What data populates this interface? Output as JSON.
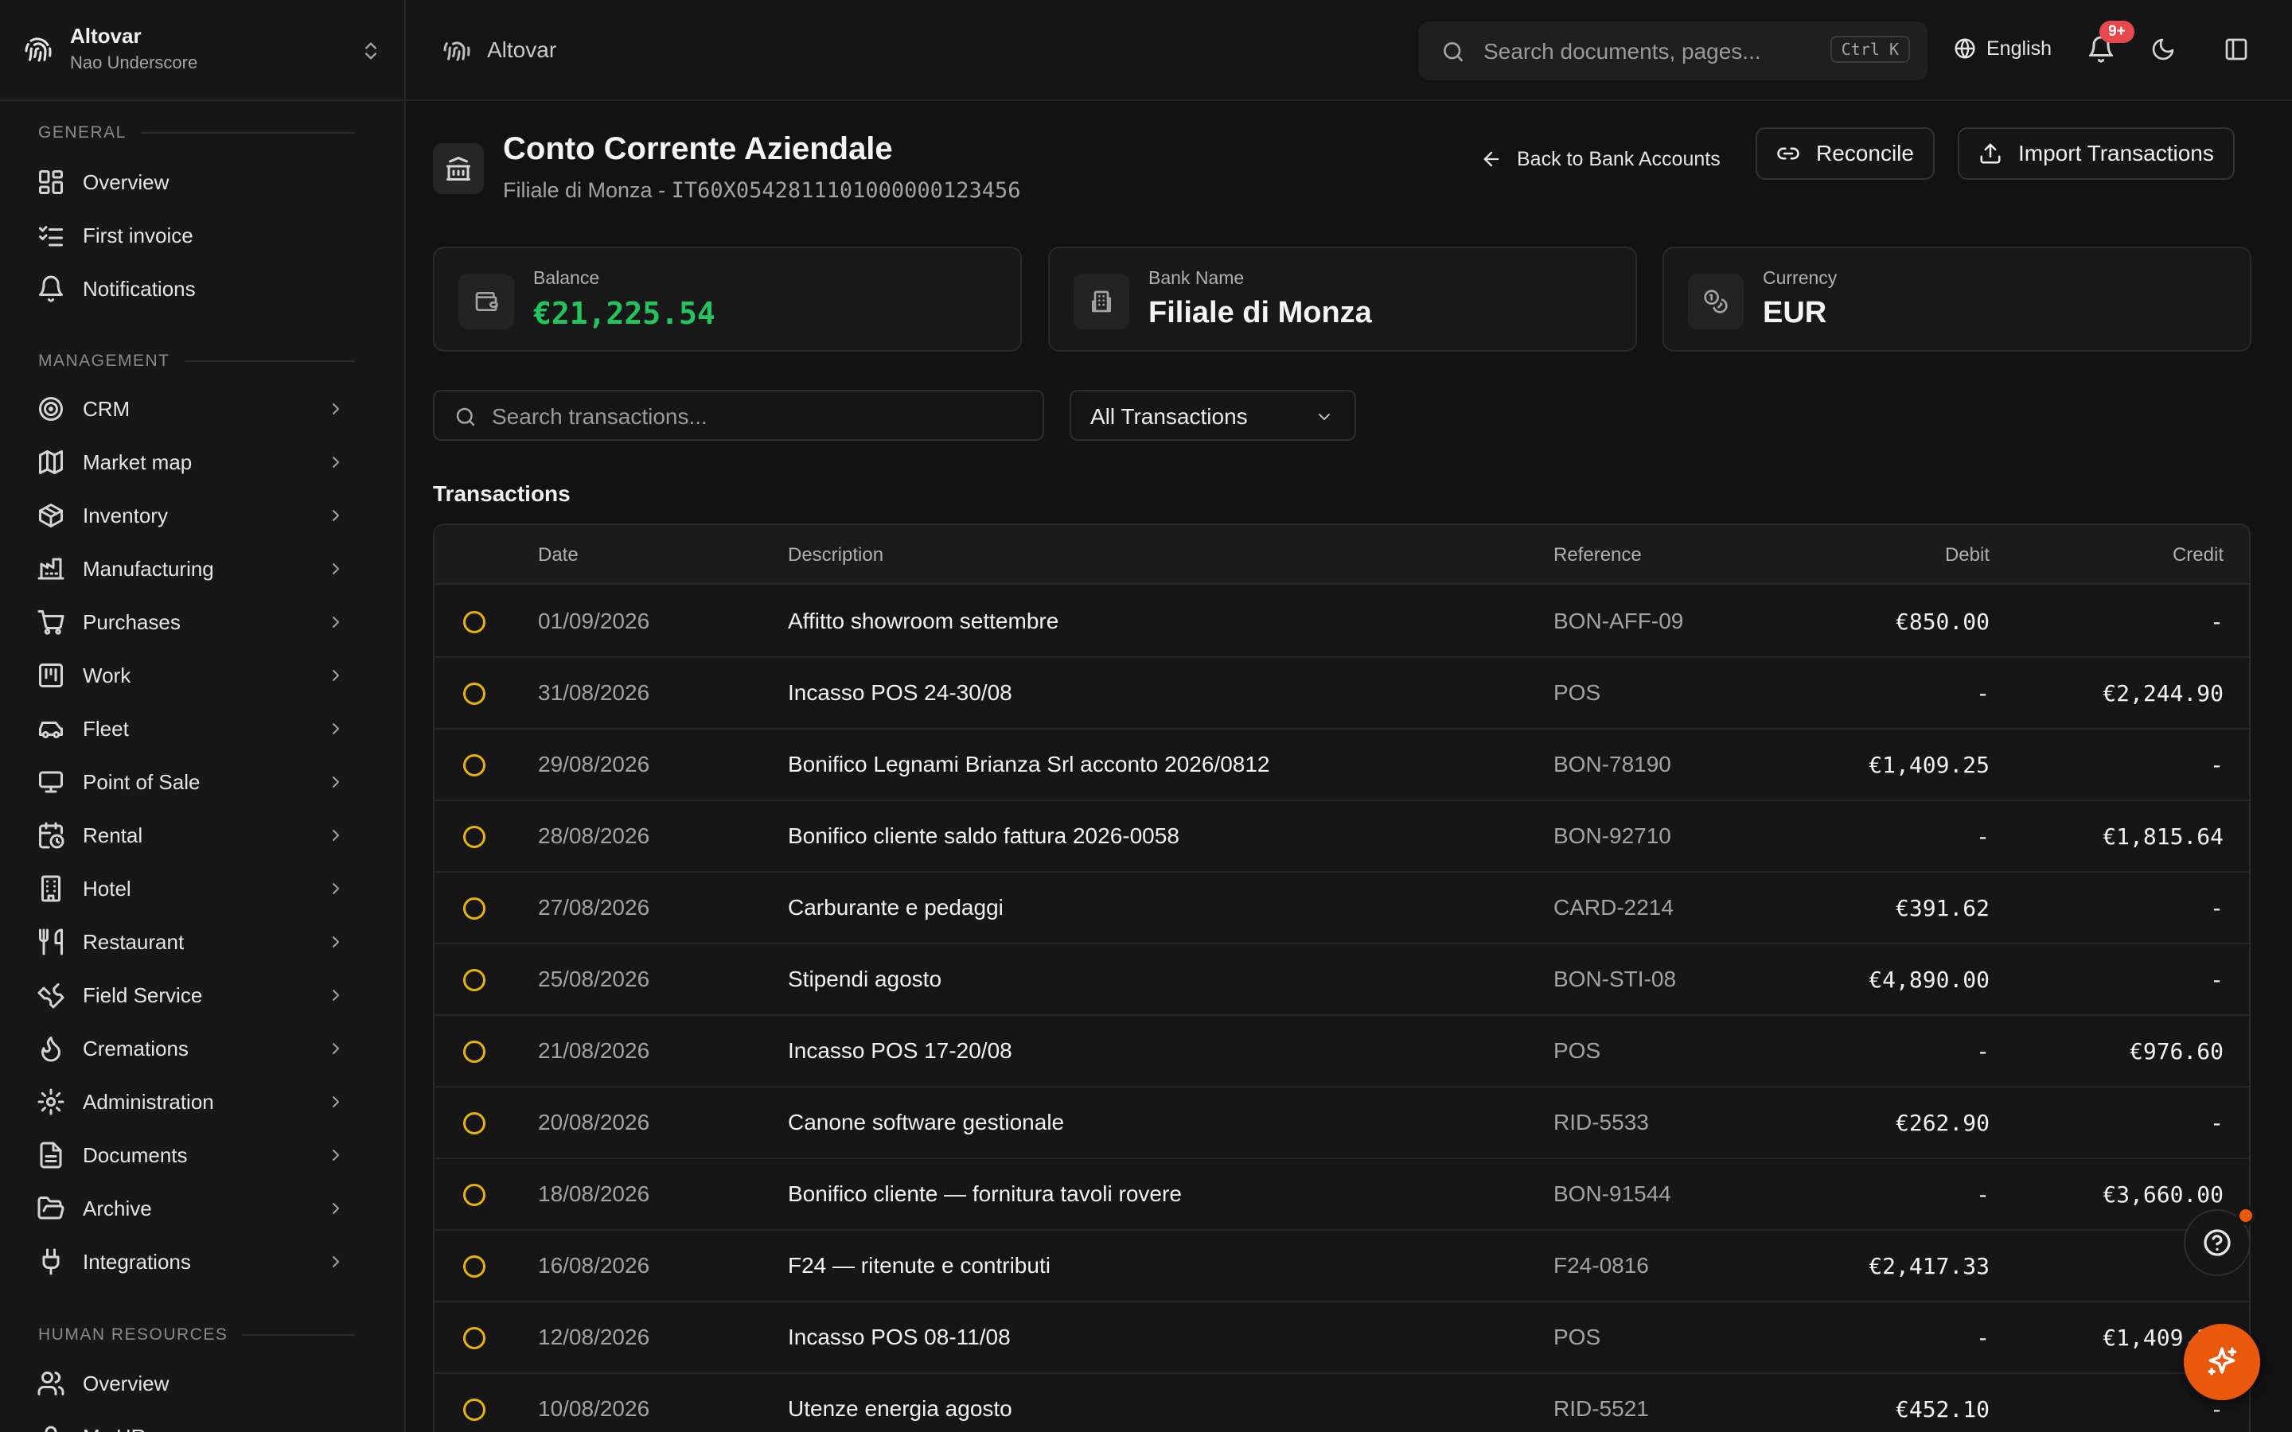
{
  "workspace": {
    "name": "Altovar",
    "user": "Nao Underscore"
  },
  "topbar": {
    "title": "Altovar",
    "search_placeholder": "Search documents, pages...",
    "shortcut": "Ctrl K",
    "language": "English",
    "notification_badge": "9+"
  },
  "sidebar": {
    "general_label": "GENERAL",
    "general": [
      {
        "label": "Overview",
        "icon": "dashboard-icon"
      },
      {
        "label": "First invoice",
        "icon": "list-check-icon"
      },
      {
        "label": "Notifications",
        "icon": "bell-icon"
      }
    ],
    "management_label": "MANAGEMENT",
    "management": [
      {
        "label": "CRM",
        "icon": "target-icon"
      },
      {
        "label": "Market map",
        "icon": "map-icon"
      },
      {
        "label": "Inventory",
        "icon": "package-icon"
      },
      {
        "label": "Manufacturing",
        "icon": "factory-icon"
      },
      {
        "label": "Purchases",
        "icon": "cart-icon"
      },
      {
        "label": "Work",
        "icon": "kanban-icon"
      },
      {
        "label": "Fleet",
        "icon": "car-icon"
      },
      {
        "label": "Point of Sale",
        "icon": "monitor-icon"
      },
      {
        "label": "Rental",
        "icon": "calendar-clock-icon"
      },
      {
        "label": "Hotel",
        "icon": "building-icon"
      },
      {
        "label": "Restaurant",
        "icon": "utensils-icon"
      },
      {
        "label": "Field Service",
        "icon": "wrench-icon"
      },
      {
        "label": "Cremations",
        "icon": "flame-icon"
      },
      {
        "label": "Administration",
        "icon": "gear-icon"
      },
      {
        "label": "Documents",
        "icon": "file-icon"
      },
      {
        "label": "Archive",
        "icon": "folder-open-icon"
      },
      {
        "label": "Integrations",
        "icon": "plug-icon"
      }
    ],
    "hr_label": "HUMAN RESOURCES",
    "hr": [
      {
        "label": "Overview",
        "icon": "users-icon"
      },
      {
        "label": "My HR",
        "icon": "user-icon"
      }
    ]
  },
  "account": {
    "title": "Conto Corrente Aziendale",
    "subtitle_branch": "Filiale di Monza - ",
    "subtitle_iban": "IT60X0542811101000000123456",
    "back_label": "Back to Bank Accounts",
    "reconcile_label": "Reconcile",
    "import_label": "Import Transactions"
  },
  "stats": {
    "balance_label": "Balance",
    "balance_value": "€21,225.54",
    "bank_label": "Bank Name",
    "bank_value": "Filiale di Monza",
    "currency_label": "Currency",
    "currency_value": "EUR"
  },
  "filters": {
    "search_placeholder": "Search transactions...",
    "type_selected": "All Transactions"
  },
  "transactions": {
    "title": "Transactions",
    "columns": {
      "date": "Date",
      "description": "Description",
      "reference": "Reference",
      "debit": "Debit",
      "credit": "Credit"
    },
    "rows": [
      {
        "date": "01/09/2026",
        "description": "Affitto showroom settembre",
        "reference": "BON-AFF-09",
        "debit": "€850.00",
        "credit": "-"
      },
      {
        "date": "31/08/2026",
        "description": "Incasso POS 24-30/08",
        "reference": "POS",
        "debit": "-",
        "credit": "€2,244.90"
      },
      {
        "date": "29/08/2026",
        "description": "Bonifico Legnami Brianza Srl acconto 2026/0812",
        "reference": "BON-78190",
        "debit": "€1,409.25",
        "credit": "-"
      },
      {
        "date": "28/08/2026",
        "description": "Bonifico cliente saldo fattura 2026-0058",
        "reference": "BON-92710",
        "debit": "-",
        "credit": "€1,815.64"
      },
      {
        "date": "27/08/2026",
        "description": "Carburante e pedaggi",
        "reference": "CARD-2214",
        "debit": "€391.62",
        "credit": "-"
      },
      {
        "date": "25/08/2026",
        "description": "Stipendi agosto",
        "reference": "BON-STI-08",
        "debit": "€4,890.00",
        "credit": "-"
      },
      {
        "date": "21/08/2026",
        "description": "Incasso POS 17-20/08",
        "reference": "POS",
        "debit": "-",
        "credit": "€976.60"
      },
      {
        "date": "20/08/2026",
        "description": "Canone software gestionale",
        "reference": "RID-5533",
        "debit": "€262.90",
        "credit": "-"
      },
      {
        "date": "18/08/2026",
        "description": "Bonifico cliente — fornitura tavoli rovere",
        "reference": "BON-91544",
        "debit": "-",
        "credit": "€3,660.00"
      },
      {
        "date": "16/08/2026",
        "description": "F24 — ritenute e contributi",
        "reference": "F24-0816",
        "debit": "€2,417.33",
        "credit": "-"
      },
      {
        "date": "12/08/2026",
        "description": "Incasso POS 08-11/08",
        "reference": "POS",
        "debit": "-",
        "credit": "€1,409.25"
      },
      {
        "date": "10/08/2026",
        "description": "Utenze energia agosto",
        "reference": "RID-5521",
        "debit": "€452.10",
        "credit": "-"
      }
    ]
  },
  "colors": {
    "accent": "#ea580c",
    "positive": "#22c55e",
    "pending": "#eab308",
    "badge": "#e5484d"
  }
}
